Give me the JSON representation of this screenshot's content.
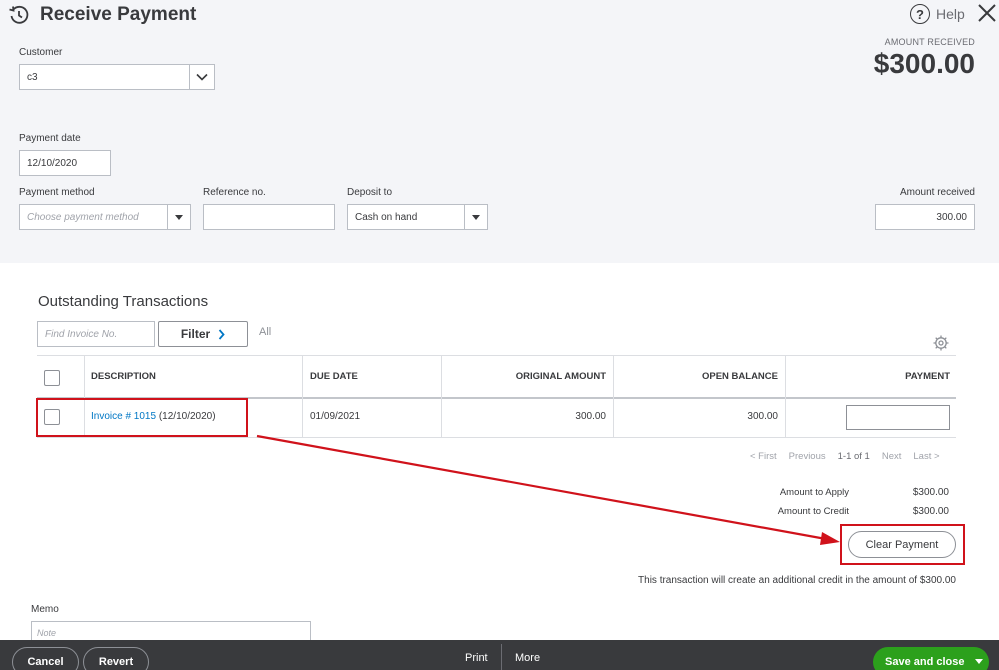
{
  "header": {
    "title": "Receive Payment",
    "help_label": "Help",
    "amount_received_caption": "AMOUNT RECEIVED",
    "amount_received_value": "$300.00"
  },
  "form": {
    "customer_label": "Customer",
    "customer_value": "c3",
    "payment_date_label": "Payment date",
    "payment_date_value": "12/10/2020",
    "payment_method_label": "Payment method",
    "payment_method_placeholder": "Choose payment method",
    "reference_label": "Reference no.",
    "reference_value": "",
    "deposit_label": "Deposit to",
    "deposit_value": "Cash on hand",
    "amount_received_label": "Amount received",
    "amount_received_value": "300.00"
  },
  "outstanding": {
    "title": "Outstanding Transactions",
    "find_placeholder": "Find Invoice No.",
    "filter_label": "Filter",
    "all_label": "All",
    "columns": [
      "DESCRIPTION",
      "DUE DATE",
      "ORIGINAL AMOUNT",
      "OPEN BALANCE",
      "PAYMENT"
    ],
    "rows": [
      {
        "invoice_link": "Invoice # 1015",
        "invoice_date": "(12/10/2020)",
        "due_date": "01/09/2021",
        "original_amount": "300.00",
        "open_balance": "300.00",
        "payment": ""
      }
    ],
    "pager": {
      "first": "< First",
      "previous": "Previous",
      "range": "1-1 of 1",
      "next": "Next",
      "last": "Last >"
    }
  },
  "summary": {
    "amount_to_apply_label": "Amount to Apply",
    "amount_to_apply_value": "$300.00",
    "amount_to_credit_label": "Amount to Credit",
    "amount_to_credit_value": "$300.00",
    "clear_payment_label": "Clear Payment",
    "credit_note": "This transaction will create an additional credit in the amount of $300.00"
  },
  "memo": {
    "label": "Memo",
    "placeholder": "Note"
  },
  "footer": {
    "cancel_label": "Cancel",
    "revert_label": "Revert",
    "print_label": "Print",
    "more_label": "More",
    "save_label": "Save and close"
  },
  "colors": {
    "accent_green": "#2ca01c",
    "link_blue": "#0077c5",
    "annotation_red": "#d0121b",
    "footer_dark": "#393a3d"
  }
}
